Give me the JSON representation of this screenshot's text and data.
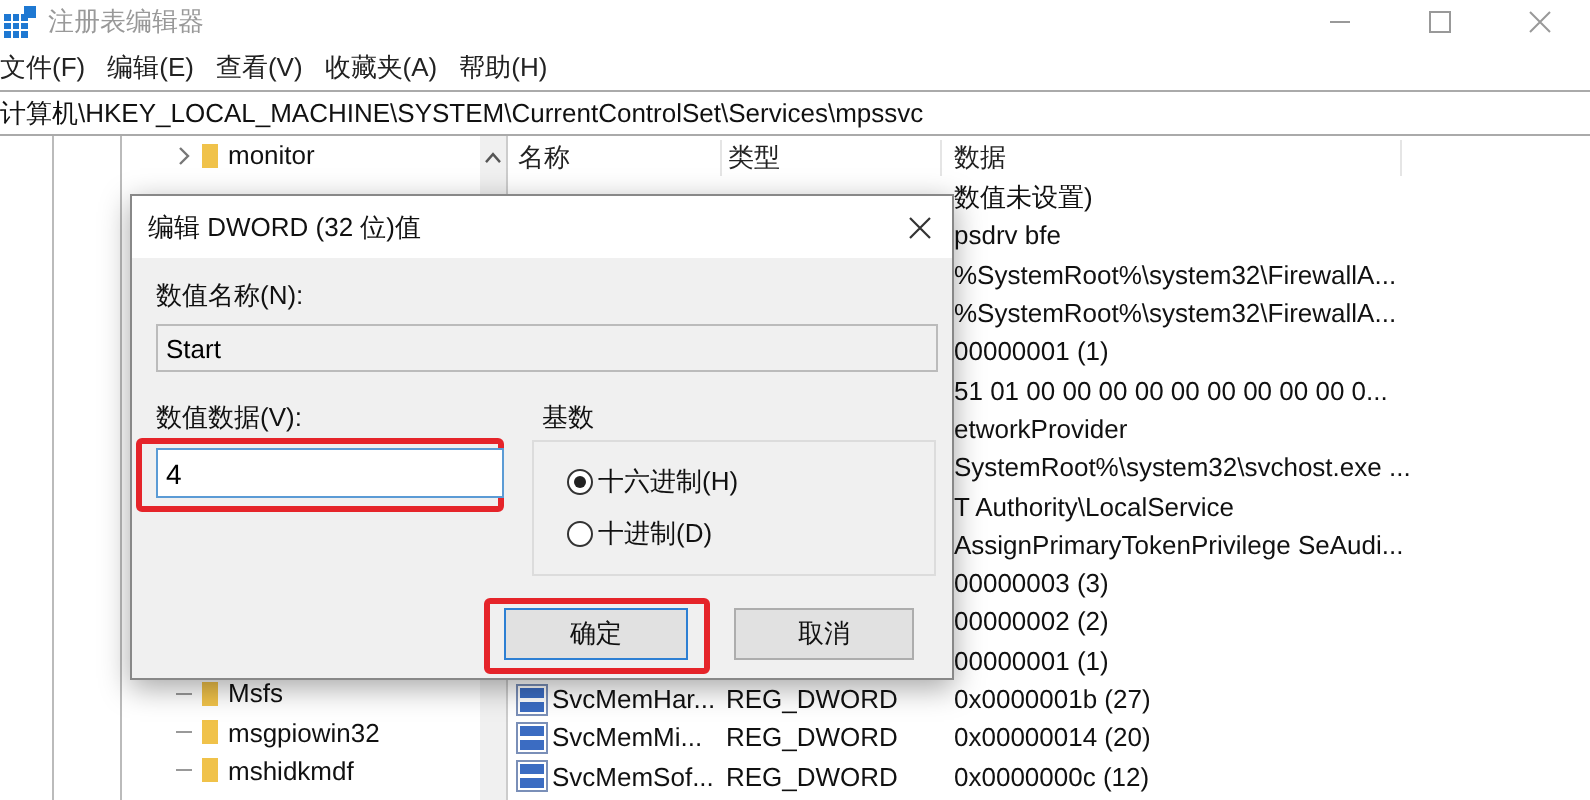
{
  "window": {
    "title": "注册表编辑器"
  },
  "menu": [
    "文件(F)",
    "编辑(E)",
    "查看(V)",
    "收藏夹(A)",
    "帮助(H)"
  ],
  "address": "计算机\\HKEY_LOCAL_MACHINE\\SYSTEM\\CurrentControlSet\\Services\\mpssvc",
  "tree": {
    "top_items": [
      {
        "label": "monitor",
        "kind": "branch"
      }
    ],
    "bottom_items": [
      {
        "label": "Msfs",
        "kind": "leaf"
      },
      {
        "label": "msgpiowin32",
        "kind": "leaf"
      },
      {
        "label": "mshidkmdf",
        "kind": "leaf"
      }
    ]
  },
  "list": {
    "columns": [
      "名称",
      "类型",
      "数据"
    ],
    "rows": [
      {
        "data": "数值未设置)"
      },
      {
        "data": "psdrv bfe"
      },
      {
        "data": "%SystemRoot%\\system32\\FirewallA..."
      },
      {
        "data": "%SystemRoot%\\system32\\FirewallA..."
      },
      {
        "data": "00000001 (1)"
      },
      {
        "data": "51 01 00 00 00 00 00 00 00 00 00 0..."
      },
      {
        "data": "etworkProvider"
      },
      {
        "data": "SystemRoot%\\system32\\svchost.exe ..."
      },
      {
        "data": "T Authority\\LocalService"
      },
      {
        "data": "AssignPrimaryTokenPrivilege SeAudi..."
      },
      {
        "data": "00000003 (3)"
      },
      {
        "data": "00000002 (2)"
      },
      {
        "data": "00000001 (1)"
      },
      {
        "name": "SvcMemHar...",
        "type": "REG_DWORD",
        "kind": "dword",
        "data": "0x0000001b (27)"
      },
      {
        "name": "SvcMemMi...",
        "type": "REG_DWORD",
        "kind": "dword",
        "data": "0x00000014 (20)"
      },
      {
        "name": "SvcMemSof...",
        "type": "REG_DWORD",
        "kind": "dword",
        "data": "0x0000000c (12)"
      }
    ]
  },
  "dialog": {
    "title": "编辑 DWORD (32 位)值",
    "name_label": "数值名称(N):",
    "name_value": "Start",
    "data_label": "数值数据(V):",
    "data_value": "4",
    "data_highlighted": true,
    "base_label": "基数",
    "bases": [
      {
        "label": "十六进制(H)",
        "selected": true
      },
      {
        "label": "十进制(D)",
        "selected": false
      }
    ],
    "buttons": [
      {
        "label": "确定",
        "default": true,
        "highlighted": true
      },
      {
        "label": "取消",
        "default": false,
        "highlighted": false
      }
    ]
  }
}
